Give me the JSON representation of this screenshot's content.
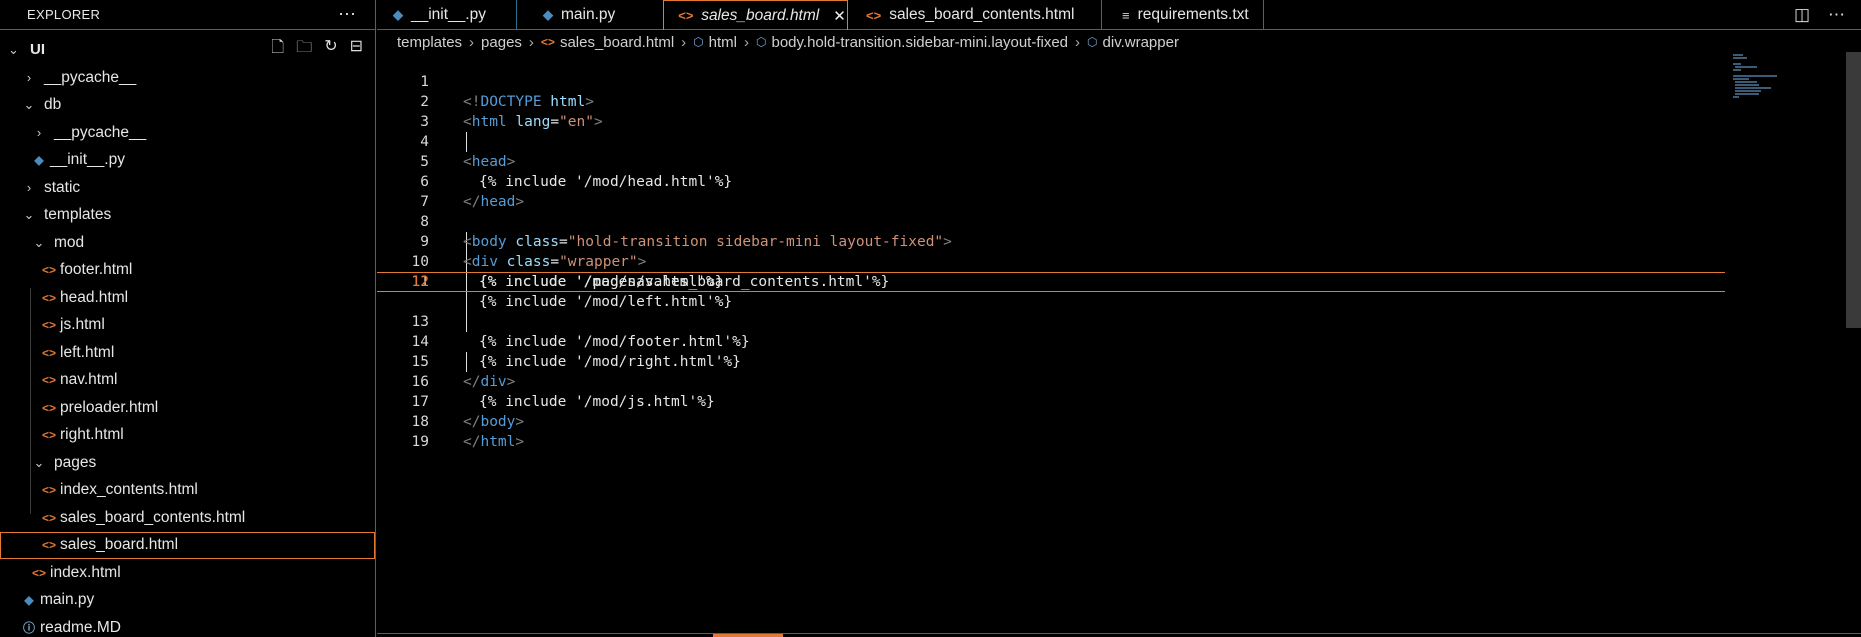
{
  "explorer": {
    "title": "EXPLORER",
    "more_icon": "⋯",
    "root_label": "UI",
    "tree": [
      {
        "label": "__pycache__",
        "type": "folder",
        "expanded": false
      },
      {
        "label": "db",
        "type": "folder",
        "expanded": true
      },
      {
        "label": "__pycache__",
        "type": "folder",
        "expanded": false
      },
      {
        "label": "__init__.py",
        "type": "py"
      },
      {
        "label": "static",
        "type": "folder",
        "expanded": false
      },
      {
        "label": "templates",
        "type": "folder",
        "expanded": true
      },
      {
        "label": "mod",
        "type": "folder",
        "expanded": true
      },
      {
        "label": "footer.html",
        "type": "html"
      },
      {
        "label": "head.html",
        "type": "html"
      },
      {
        "label": "js.html",
        "type": "html"
      },
      {
        "label": "left.html",
        "type": "html"
      },
      {
        "label": "nav.html",
        "type": "html"
      },
      {
        "label": "preloader.html",
        "type": "html"
      },
      {
        "label": "right.html",
        "type": "html"
      },
      {
        "label": "pages",
        "type": "folder",
        "expanded": true
      },
      {
        "label": "index_contents.html",
        "type": "html"
      },
      {
        "label": "sales_board_contents.html",
        "type": "html"
      },
      {
        "label": "sales_board.html",
        "type": "html",
        "selected": true
      },
      {
        "label": "index.html",
        "type": "html"
      },
      {
        "label": "main.py",
        "type": "py"
      },
      {
        "label": "readme.MD",
        "type": "info"
      }
    ]
  },
  "tabs": [
    {
      "label": "__init__.py",
      "type": "py"
    },
    {
      "label": "main.py",
      "type": "py"
    },
    {
      "label": "sales_board.html",
      "type": "html",
      "active": true,
      "close": "✕"
    },
    {
      "label": "sales_board_contents.html",
      "type": "html"
    },
    {
      "label": "requirements.txt",
      "type": "txt"
    }
  ],
  "breadcrumb": {
    "folder1": "templates",
    "folder2": "pages",
    "file": "sales_board.html",
    "el1": "html",
    "el2": "body.hold-transition.sidebar-mini.layout-fixed",
    "el3": "div.wrapper"
  },
  "editor": {
    "current_line": 12,
    "lines": [
      {
        "n": "1"
      },
      {
        "n": "2"
      },
      {
        "n": "3"
      },
      {
        "n": "4"
      },
      {
        "n": "5"
      },
      {
        "n": "6"
      },
      {
        "n": "7"
      },
      {
        "n": "8"
      },
      {
        "n": "9"
      },
      {
        "n": "10"
      },
      {
        "n": "11"
      },
      {
        "n": "12"
      },
      {
        "n": "13"
      },
      {
        "n": "14"
      },
      {
        "n": "15"
      },
      {
        "n": "16"
      },
      {
        "n": "17"
      },
      {
        "n": "18"
      },
      {
        "n": "19"
      }
    ],
    "code": {
      "l1_a": "<!",
      "l1_b": "DOCTYPE",
      "l1_c": " html",
      "l1_d": ">",
      "l2_a": "<",
      "l2_b": "html",
      "l2_c": " lang",
      "l2_d": "=",
      "l2_e": "\"en\"",
      "l2_f": ">",
      "l4_a": "<",
      "l4_b": "head",
      "l4_c": ">",
      "l5": "{% include '/mod/head.html'%}",
      "l6_a": "</",
      "l6_b": "head",
      "l6_c": ">",
      "l8_a": "<",
      "l8_b": "body",
      "l8_c": " class",
      "l8_d": "=",
      "l8_e": "\"hold-transition sidebar-mini layout-fixed\"",
      "l8_f": ">",
      "l9_a": "<",
      "l9_b": "div",
      "l9_c": " class",
      "l9_d": "=",
      "l9_e": "\"wrapper\"",
      "l9_f": ">",
      "l10": "{% include '/mod/nav.html'%}",
      "l11": "{% include '/mod/left.html'%}",
      "l12": "{% include '/pages/sales_board_contents.html'%}",
      "l13": "{% include '/mod/footer.html'%}",
      "l14": "{% include '/mod/right.html'%}",
      "l15_a": "</",
      "l15_b": "div",
      "l15_c": ">",
      "l16": "{% include '/mod/js.html'%}",
      "l17_a": "</",
      "l17_b": "body",
      "l17_c": ">",
      "l18_a": "</",
      "l18_b": "html",
      "l18_c": ">"
    }
  },
  "colors": {
    "accent": "#e37933",
    "border": "#2b6f8a",
    "tag": "#569cd6",
    "attr": "#9cdcfe",
    "string": "#ce9178"
  }
}
